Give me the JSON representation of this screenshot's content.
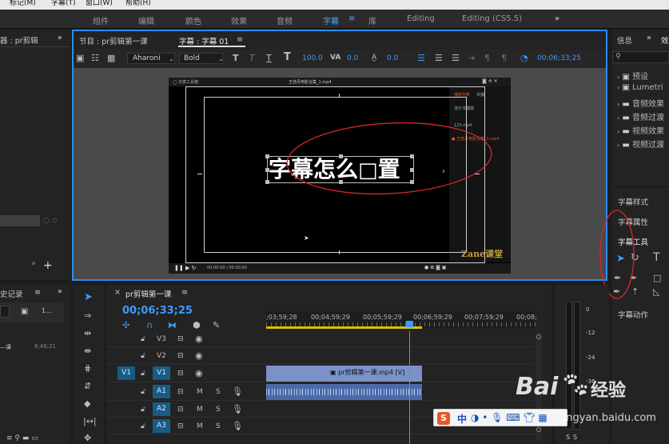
{
  "menubar": {
    "items": [
      "标记(M)",
      "字幕(T)",
      "窗口(W)",
      "帮助(H)"
    ]
  },
  "workspaces": {
    "tabs": [
      "组件",
      "编辑",
      "颜色",
      "效果",
      "音频",
      "字幕",
      "库",
      "Editing",
      "Editing (CS5.5)"
    ],
    "active": "字幕",
    "menu_glyph": "≡",
    "more": "»"
  },
  "left_panel": {
    "tab_label": "器 : pr剪辑",
    "more": "»",
    "add": "+"
  },
  "monitor": {
    "tab_program": "节目 : pr剪辑第一课",
    "tab_title": "字幕 : 字幕 01",
    "tab_menu": "≡"
  },
  "title_toolbar": {
    "font_family": "Aharoni",
    "font_style": "Bold",
    "font_size": "100.0",
    "kerning": "0.0",
    "leading": "0.0",
    "timecode": "00;06;33;25"
  },
  "video_frame": {
    "top_label_left": "◯ 仿真工具箱",
    "top_title": "王佳丹电影合集_1.mp4",
    "side_items": [
      "播放列表",
      "共播",
      "流计书模版",
      "123.mp4",
      "● 王佳丹电影合集_1.mp4"
    ],
    "caption_text": "字幕怎么",
    "caption_broken": "□",
    "caption_tail": "置",
    "watermark": "Zane课堂",
    "player_time": "00:00:00 / 00:00:00"
  },
  "right_panel": {
    "tab_info": "信息",
    "tab_effects": "效",
    "more": "»",
    "tree": [
      "预设",
      "Lumetri",
      "音频效果",
      "音频过渡",
      "视频效果",
      "视频过渡"
    ],
    "sections": [
      "字幕样式",
      "字幕属性",
      "字幕工具",
      "字幕动作"
    ]
  },
  "history_panel": {
    "tab_label": "史记录",
    "menu": "≡",
    "more": "»",
    "item_label": "—课",
    "item_value": "6;48;21",
    "count": "1..."
  },
  "timeline": {
    "close": "×",
    "sequence_name": "pr剪辑第一课",
    "menu": "≡",
    "timecode": "00;06;33;25",
    "ruler": [
      ";03;59;28",
      "00;04;59;29",
      "00;05;59;29",
      "00;06;59;29",
      "00;07;59;29",
      "00;08;"
    ],
    "tracks": [
      {
        "label": "V3",
        "kind": "video"
      },
      {
        "label": "V2",
        "kind": "video"
      },
      {
        "label": "V1",
        "kind": "video",
        "source": "V1"
      },
      {
        "label": "A1",
        "kind": "audio"
      },
      {
        "label": "A2",
        "kind": "audio"
      },
      {
        "label": "A3",
        "kind": "audio"
      }
    ],
    "clip_name": "pr剪辑第一课.mp4 [V]",
    "mute": "M",
    "solo": "S"
  },
  "audio_meter": {
    "scale": [
      "0",
      "-12",
      "-24",
      "-36"
    ],
    "solo": [
      "S",
      "S"
    ]
  },
  "ime": {
    "logo": "S",
    "lang": "中"
  },
  "baidu": {
    "text_bai": "Bai",
    "text_du": "经验",
    "url": "jingyan.baidu.com"
  },
  "colors": {
    "accent": "#3d9bff",
    "panel_border": "#2d8cf0",
    "annotation": "#d8262c",
    "clip": "#7a92c8",
    "track_button": "#1a5b86",
    "playhead_bar": "#d7c400"
  }
}
